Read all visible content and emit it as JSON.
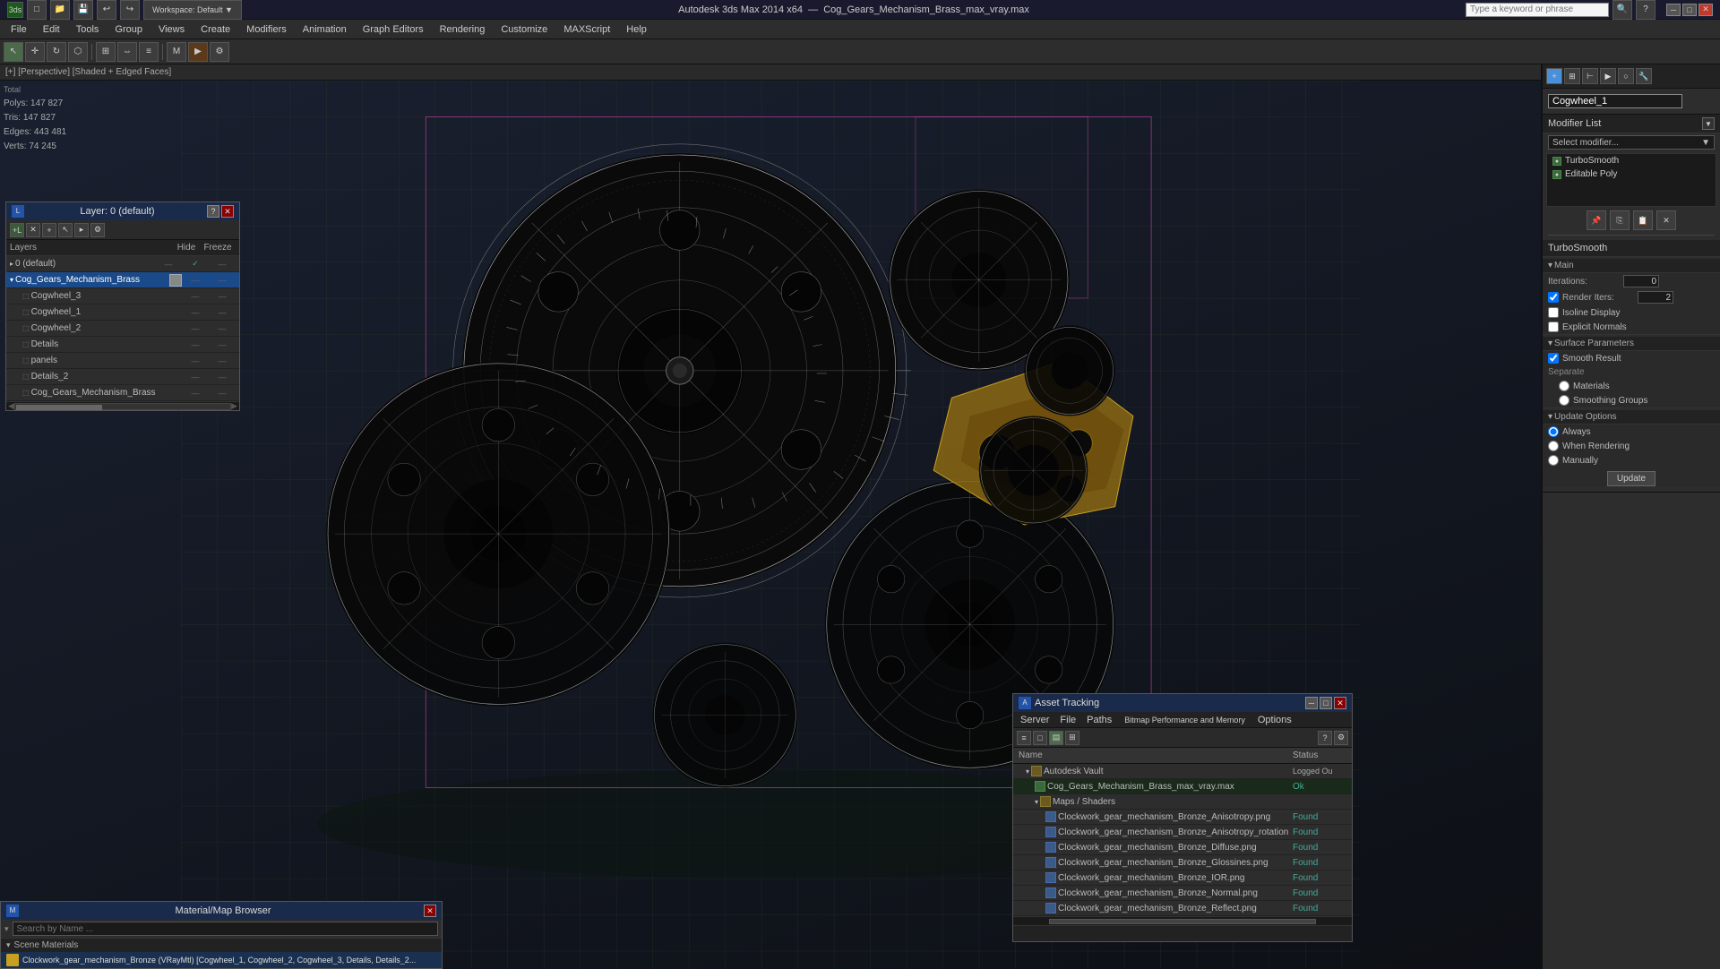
{
  "titlebar": {
    "app_name": "Autodesk 3ds Max 2014 x64",
    "file_name": "Cog_Gears_Mechanism_Brass_max_vray.max",
    "search_placeholder": "Type a keyword or phrase",
    "minimize": "─",
    "maximize": "□",
    "close": "✕"
  },
  "menubar": {
    "items": [
      "File",
      "Edit",
      "Tools",
      "Group",
      "Views",
      "Create",
      "Modifiers",
      "Animation",
      "Graph Editors",
      "Rendering",
      "Customize",
      "MAXScript",
      "Help"
    ]
  },
  "viewport": {
    "label": "[+] [Perspective] [Shaded + Edged Faces]",
    "stats": {
      "polys_label": "Polys:",
      "polys_val": "147 827",
      "tris_label": "Tris:",
      "tris_val": "147 827",
      "edges_label": "Edges:",
      "edges_val": "443 481",
      "verts_label": "Verts:",
      "verts_val": "74 245",
      "total_label": "Total"
    }
  },
  "layers_window": {
    "title": "Layer: 0 (default)",
    "help": "?",
    "close": "✕",
    "header": {
      "name": "Layers",
      "hide": "Hide",
      "freeze": "Freeze"
    },
    "rows": [
      {
        "id": "default",
        "name": "0 (default)",
        "level": 0,
        "has_check": true,
        "selected": false
      },
      {
        "id": "cog_brass",
        "name": "Cog_Gears_Mechanism_Brass",
        "level": 0,
        "has_check": false,
        "selected": true
      },
      {
        "id": "cogwheel3",
        "name": "Cogwheel_3",
        "level": 1,
        "selected": false
      },
      {
        "id": "cogwheel1",
        "name": "Cogwheel_1",
        "level": 1,
        "selected": false
      },
      {
        "id": "cogwheel2",
        "name": "Cogwheel_2",
        "level": 1,
        "selected": false
      },
      {
        "id": "details",
        "name": "Details",
        "level": 1,
        "selected": false
      },
      {
        "id": "panels",
        "name": "panels",
        "level": 1,
        "selected": false
      },
      {
        "id": "details2",
        "name": "Details_2",
        "level": 1,
        "selected": false
      },
      {
        "id": "cog_brass2",
        "name": "Cog_Gears_Mechanism_Brass",
        "level": 1,
        "selected": false
      }
    ]
  },
  "right_panel": {
    "object_name": "Cogwheel_1",
    "modifier_list_label": "Modifier List",
    "modifiers": [
      {
        "name": "TurboSmooth",
        "selected": false
      },
      {
        "name": "Editable Poly",
        "selected": false
      }
    ],
    "turbosmooth": {
      "label": "TurboSmooth",
      "main_label": "Main",
      "iterations_label": "Iterations:",
      "iterations_val": "0",
      "render_iters_label": "Render Iters:",
      "render_iters_val": "2",
      "isoline_label": "Isoline Display",
      "explicit_label": "Explicit Normals",
      "surface_label": "Surface Parameters",
      "smooth_result_label": "Smooth Result",
      "separate_label": "Separate",
      "materials_label": "Materials",
      "smoothing_label": "Smoothing Groups",
      "update_label": "Update Options",
      "always_label": "Always",
      "when_rendering_label": "When Rendering",
      "manually_label": "Manually",
      "update_btn": "Update"
    }
  },
  "material_window": {
    "title": "Material/Map Browser",
    "close": "✕",
    "search_placeholder": "Search by Name ...",
    "scene_materials_label": "Scene Materials",
    "material_name": "Clockwork_gear_mechanism_Bronze (VRayMtl) [Cogwheel_1, Cogwheel_2, Cogwheel_3, Details, Details_2..."
  },
  "asset_tracking": {
    "title": "Asset Tracking",
    "server_label": "Server",
    "file_label": "File",
    "paths_label": "Paths",
    "bitmap_label": "Bitmap Performance and Memory",
    "options_label": "Options",
    "col_name": "Name",
    "col_status": "Status",
    "rows": [
      {
        "level": 0,
        "type": "folder",
        "name": "Autodesk Vault",
        "status": "Logged Ou"
      },
      {
        "level": 1,
        "type": "file",
        "name": "Cog_Gears_Mechanism_Brass_max_vray.max",
        "status": "Ok"
      },
      {
        "level": 1,
        "type": "folder",
        "name": "Maps / Shaders",
        "status": ""
      },
      {
        "level": 2,
        "type": "image",
        "name": "Clockwork_gear_mechanism_Bronze_Anisotropy.png",
        "status": "Found"
      },
      {
        "level": 2,
        "type": "image",
        "name": "Clockwork_gear_mechanism_Bronze_Anisotropy_rotation.png",
        "status": "Found"
      },
      {
        "level": 2,
        "type": "image",
        "name": "Clockwork_gear_mechanism_Bronze_Diffuse.png",
        "status": "Found"
      },
      {
        "level": 2,
        "type": "image",
        "name": "Clockwork_gear_mechanism_Bronze_Glossines.png",
        "status": "Found"
      },
      {
        "level": 2,
        "type": "image",
        "name": "Clockwork_gear_mechanism_Bronze_IOR.png",
        "status": "Found"
      },
      {
        "level": 2,
        "type": "image",
        "name": "Clockwork_gear_mechanism_Bronze_Normal.png",
        "status": "Found"
      },
      {
        "level": 2,
        "type": "image",
        "name": "Clockwork_gear_mechanism_Bronze_Reflect.png",
        "status": "Found"
      }
    ]
  }
}
